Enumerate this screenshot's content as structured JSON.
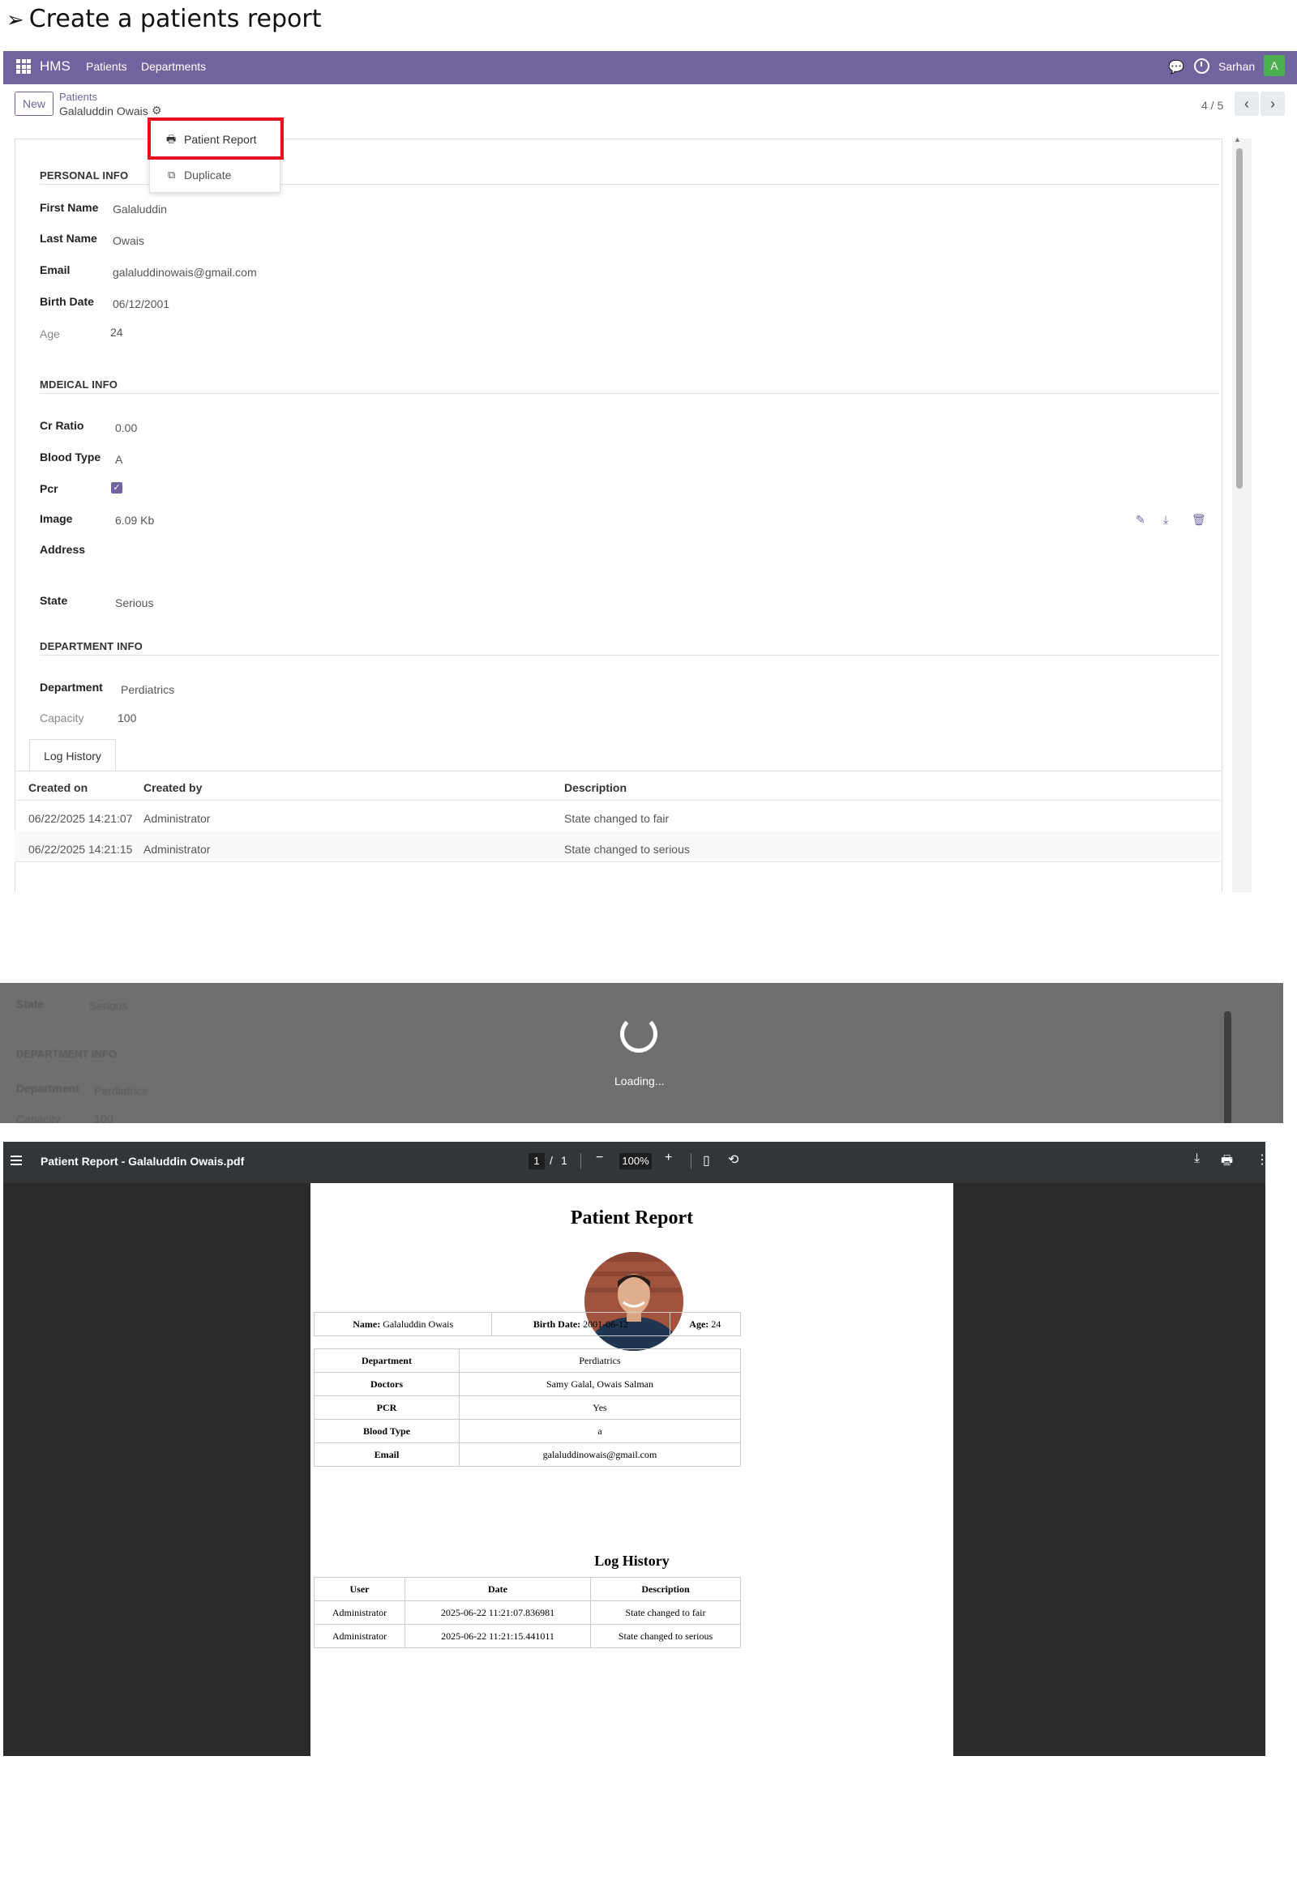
{
  "heading": "Create a patients report",
  "navbar": {
    "brand": "HMS",
    "menu": [
      "Patients",
      "Departments"
    ],
    "user": "Sarhan",
    "avatar_letter": "A",
    "color": "#71639e"
  },
  "control": {
    "new_label": "New",
    "breadcrumb_parent": "Patients",
    "breadcrumb_current": "Galaluddin Owais",
    "pager": "4 / 5"
  },
  "action_menu": {
    "items": [
      "Patient Report",
      "Duplicate"
    ],
    "highlight_color": "#e3101d"
  },
  "form": {
    "personal_info": {
      "title": "PERSONAL INFO",
      "first_name_label": "First Name",
      "first_name": "Galaluddin",
      "last_name_label": "Last Name",
      "last_name": "Owais",
      "email_label": "Email",
      "email": "galaluddinowais@gmail.com",
      "birth_date_label": "Birth Date",
      "birth_date": "06/12/2001",
      "age_label": "Age",
      "age": "24"
    },
    "medical_info": {
      "title": "MDEICAL INFO",
      "cr_ratio_label": "Cr Ratio",
      "cr_ratio": "0.00",
      "blood_type_label": "Blood Type",
      "blood_type": "A",
      "pcr_label": "Pcr",
      "pcr_checked": true,
      "image_label": "Image",
      "image_size": "6.09 Kb",
      "address_label": "Address",
      "state_label": "State",
      "state": "Serious"
    },
    "department_info": {
      "title": "DEPARTMENT INFO",
      "department_label": "Department",
      "department": "Perdiatrics",
      "capacity_label": "Capacity",
      "capacity": "100"
    },
    "log_tab": "Log History",
    "log_columns": [
      "Created on",
      "Created by",
      "Description"
    ],
    "log_rows": [
      {
        "created_on": "06/22/2025 14:21:07",
        "created_by": "Administrator",
        "description": "State changed to fair"
      },
      {
        "created_on": "06/22/2025 14:21:15",
        "created_by": "Administrator",
        "description": "State changed to serious"
      }
    ]
  },
  "loading": {
    "text": "Loading...",
    "ghost": [
      "State",
      "Serious",
      "DEPARTMENT INFO",
      "Department",
      "Perdiatrics",
      "Capacity",
      "100"
    ]
  },
  "pdf": {
    "filename": "Patient Report - Galaluddin Owais.pdf",
    "page_current": "1",
    "page_total": "1",
    "zoom": "100%",
    "title": "Patient Report",
    "summary": {
      "name_label": "Name:",
      "name": "Galaluddin Owais",
      "birth_label": "Birth Date:",
      "birth": "2001-06-12",
      "age_label": "Age:",
      "age": "24"
    },
    "details": [
      {
        "label": "Department",
        "value": "Perdiatrics"
      },
      {
        "label": "Doctors",
        "value": "Samy Galal, Owais Salman"
      },
      {
        "label": "PCR",
        "value": "Yes"
      },
      {
        "label": "Blood Type",
        "value": "a"
      },
      {
        "label": "Email",
        "value": "galaluddinowais@gmail.com"
      }
    ],
    "log_title": "Log History",
    "log_columns": [
      "User",
      "Date",
      "Description"
    ],
    "log_rows": [
      {
        "user": "Administrator",
        "date": "2025-06-22 11:21:07.836981",
        "description": "State changed to fair"
      },
      {
        "user": "Administrator",
        "date": "2025-06-22 11:21:15.441011",
        "description": "State changed to serious"
      }
    ]
  }
}
